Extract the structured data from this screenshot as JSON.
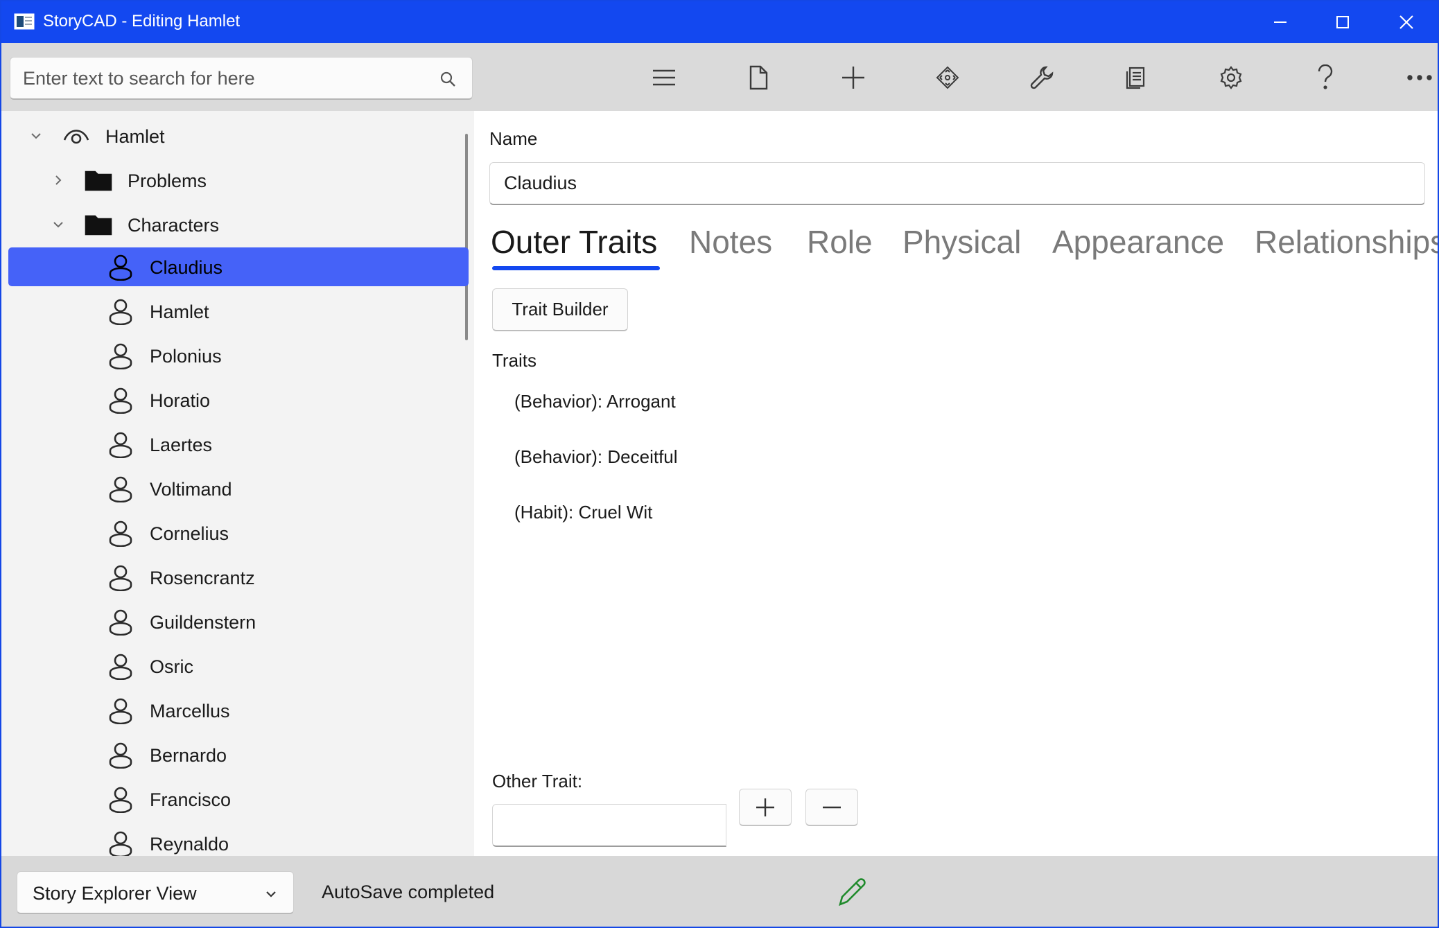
{
  "titlebar": {
    "title": "StoryCAD - Editing Hamlet"
  },
  "search": {
    "placeholder": "Enter text to search for here"
  },
  "toolbar": {
    "icons": [
      "menu-icon",
      "new-file-icon",
      "add-icon",
      "move-icon",
      "tools-icon",
      "reports-icon",
      "settings-icon",
      "help-icon",
      "more-icon"
    ]
  },
  "tree": {
    "root": "Hamlet",
    "problems": "Problems",
    "characters": "Characters",
    "items": [
      "Claudius",
      "Hamlet",
      "Polonius",
      "Horatio",
      "Laertes",
      "Voltimand",
      "Cornelius",
      "Rosencrantz",
      "Guildenstern",
      "Osric",
      "Marcellus",
      "Bernardo",
      "Francisco",
      "Reynaldo"
    ],
    "selected": "Claudius"
  },
  "content": {
    "name_label": "Name",
    "name_value": "Claudius",
    "tabs": [
      "Outer Traits",
      "Notes",
      "Role",
      "Physical",
      "Appearance",
      "Relationships"
    ],
    "active_tab": "Outer Traits",
    "trait_builder_label": "Trait Builder",
    "traits_label": "Traits",
    "traits": [
      "(Behavior): Arrogant",
      "(Behavior): Deceitful",
      "(Habit): Cruel Wit"
    ],
    "other_trait_label": "Other Trait:",
    "other_trait_value": ""
  },
  "statusbar": {
    "view_label": "Story Explorer View",
    "status": "AutoSave completed"
  },
  "colors": {
    "accent": "#1348f0",
    "selection": "#4562f8",
    "edit_indicator": "#1f8a2b"
  }
}
